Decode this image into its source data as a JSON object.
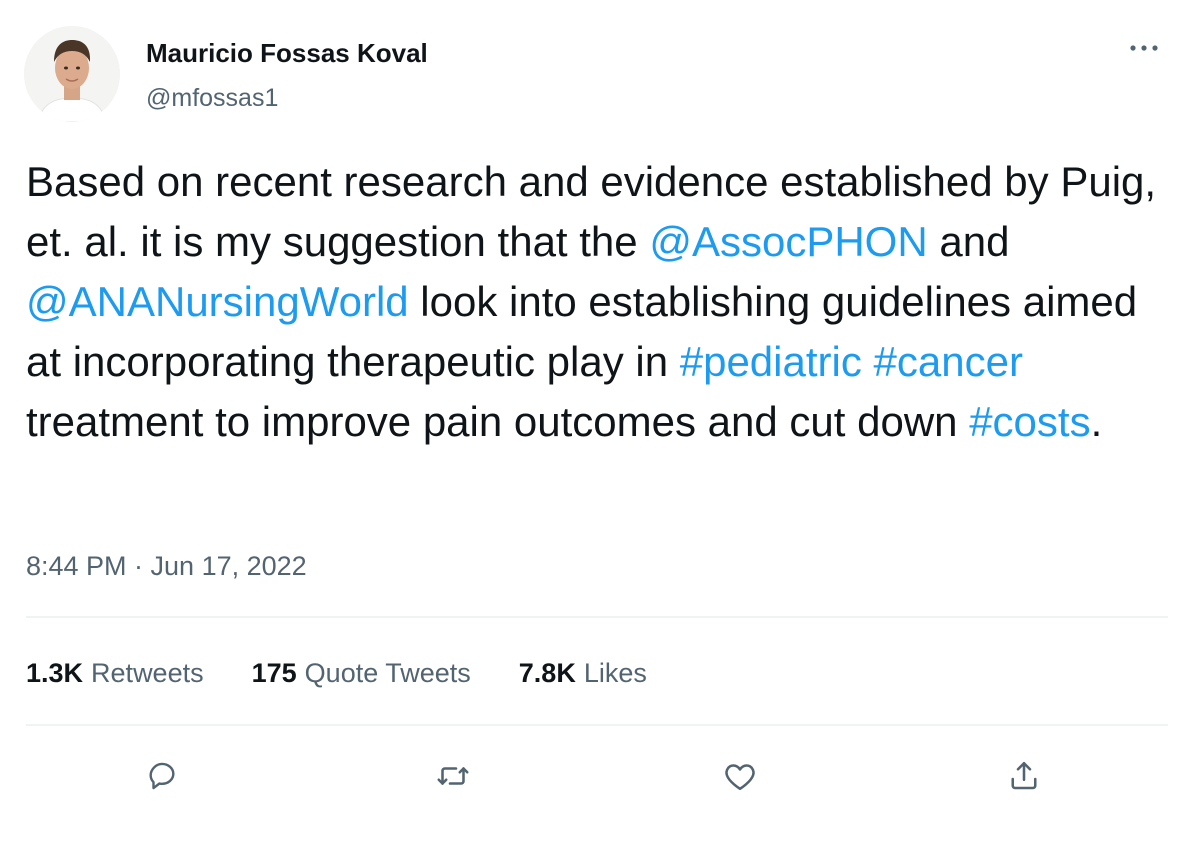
{
  "author": {
    "display_name": "Mauricio Fossas Koval",
    "handle": "@mfossas1"
  },
  "tweet": {
    "text_segments": [
      {
        "text": "Based on recent research and evidence established by Puig, et. al. it is my suggestion that the ",
        "type": "text"
      },
      {
        "text": "@AssocPHON",
        "type": "mention"
      },
      {
        "text": " and ",
        "type": "text"
      },
      {
        "text": "@ANANursingWorld",
        "type": "mention"
      },
      {
        "text": " look into establishing guidelines aimed at incorporating therapeutic play in ",
        "type": "text"
      },
      {
        "text": "#pediatric",
        "type": "hashtag"
      },
      {
        "text": " ",
        "type": "text"
      },
      {
        "text": "#cancer",
        "type": "hashtag"
      },
      {
        "text": " treatment to improve pain outcomes and cut down ",
        "type": "text"
      },
      {
        "text": "#costs",
        "type": "hashtag"
      },
      {
        "text": ".",
        "type": "text"
      }
    ],
    "timestamp": "8:44 PM · Jun 17, 2022"
  },
  "stats": {
    "retweets_count": "1.3K",
    "retweets_label": "Retweets",
    "quotes_count": "175",
    "quotes_label": "Quote Tweets",
    "likes_count": "7.8K",
    "likes_label": "Likes"
  },
  "actions": {
    "reply_icon": "reply-icon",
    "retweet_icon": "retweet-icon",
    "like_icon": "heart-icon",
    "share_icon": "share-icon"
  },
  "colors": {
    "link": "#1d9bf0",
    "text": "#0f1419",
    "secondary": "#536471",
    "divider": "#eff3f4"
  }
}
